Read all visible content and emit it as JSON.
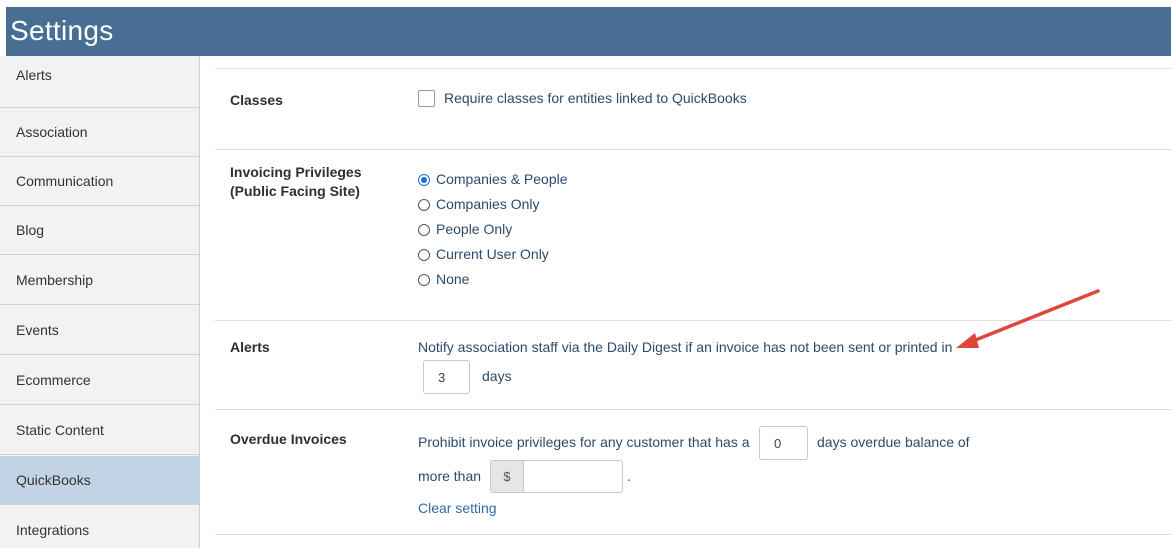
{
  "header": {
    "title": "Settings"
  },
  "sidebar": {
    "items": [
      {
        "label": "Alerts",
        "active": false
      },
      {
        "label": "Association",
        "active": false
      },
      {
        "label": "Communication",
        "active": false
      },
      {
        "label": "Blog",
        "active": false
      },
      {
        "label": "Membership",
        "active": false
      },
      {
        "label": "Events",
        "active": false
      },
      {
        "label": "Ecommerce",
        "active": false
      },
      {
        "label": "Static Content",
        "active": false
      },
      {
        "label": "QuickBooks",
        "active": true
      },
      {
        "label": "Integrations",
        "active": false
      }
    ]
  },
  "main": {
    "classes": {
      "label": "Classes",
      "checkbox_label": "Require classes for entities linked to QuickBooks",
      "checked": false
    },
    "invoicing": {
      "label_line1": "Invoicing Privileges",
      "label_line2": "(Public Facing Site)",
      "options": [
        {
          "label": "Companies & People",
          "checked": true
        },
        {
          "label": "Companies Only",
          "checked": false
        },
        {
          "label": "People Only",
          "checked": false
        },
        {
          "label": "Current User Only",
          "checked": false
        },
        {
          "label": "None",
          "checked": false
        }
      ]
    },
    "alerts": {
      "label": "Alerts",
      "text": "Notify association staff via the Daily Digest if an invoice has not been sent or printed in",
      "days_value": "3",
      "days_suffix": "days"
    },
    "overdue": {
      "label": "Overdue Invoices",
      "text_before": "Prohibit invoice privileges for any customer that has a",
      "days_value": "0",
      "text_after": "days overdue balance of",
      "text_more": "more than",
      "currency_symbol": "$",
      "amount_value": "",
      "period": ".",
      "clear_link": "Clear setting"
    }
  },
  "colors": {
    "header_bg": "#486f93",
    "sidebar_active": "#c2d3e6",
    "annotation_arrow": "#e0463a",
    "link": "#2f6aa8"
  }
}
